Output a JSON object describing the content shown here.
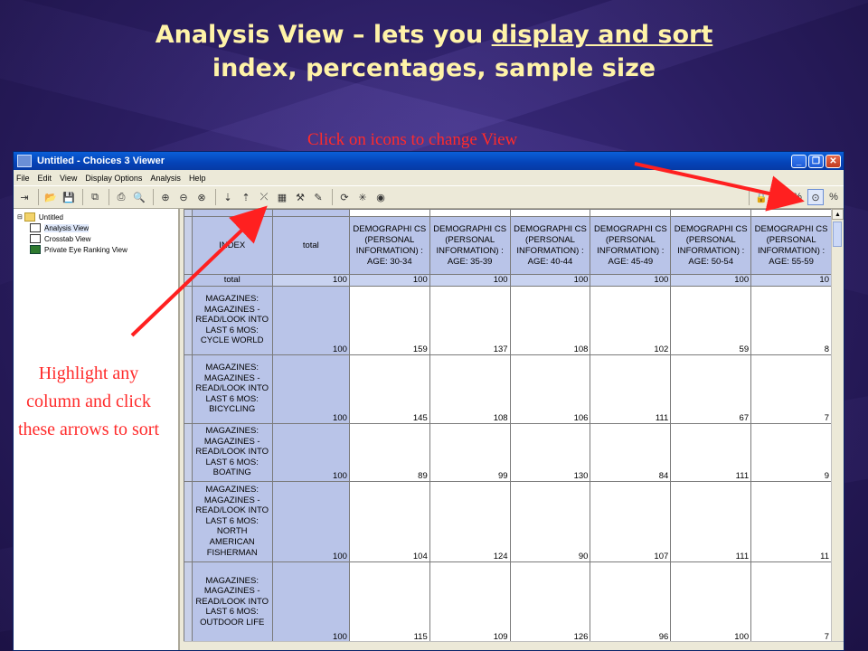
{
  "slide": {
    "title_line1_part1": "Analysis View – lets you ",
    "title_line1_underlined": "display and sort",
    "title_line2": "index, percentages, sample size",
    "hint_top": "Click on icons to change View",
    "hint_left": "Highlight any column and click these arrows to sort"
  },
  "window": {
    "title": "Untitled - Choices 3 Viewer",
    "minimize_label": "_",
    "restore_label": "❐",
    "close_label": "✕"
  },
  "menu": {
    "items": [
      "File",
      "Edit",
      "View",
      "Display Options",
      "Analysis",
      "Help"
    ]
  },
  "toolbar": {
    "icons": [
      "expand-icon",
      "open-folder-icon",
      "save-icon",
      "copy-icon",
      "print-icon",
      "print-preview-icon",
      "zoom-in-icon",
      "zoom-out-icon",
      "zoom-reset-icon",
      "sort-descending-icon",
      "sort-ascending-icon",
      "filter-remove-icon",
      "chart-icon",
      "tools-icon",
      "highlight-icon",
      "refresh-icon",
      "sparkle-icon",
      "globe-icon",
      "lock-icon",
      "users-icon",
      "percent-column-icon",
      "index-100-icon",
      "percent-row-icon"
    ]
  },
  "tree": {
    "root": "Untitled",
    "items": [
      "Analysis View",
      "Crosstab View",
      "Private Eye Ranking View"
    ]
  },
  "grid": {
    "corner_label": "INDEX",
    "total_header": "total",
    "columns": [
      "DEMOGRAPHI CS (PERSONAL INFORMATION) : AGE: 30-34",
      "DEMOGRAPHI CS (PERSONAL INFORMATION) : AGE: 35-39",
      "DEMOGRAPHI CS (PERSONAL INFORMATION) : AGE: 40-44",
      "DEMOGRAPHI CS (PERSONAL INFORMATION) : AGE: 45-49",
      "DEMOGRAPHI CS (PERSONAL INFORMATION) : AGE: 50-54",
      "DEMOGRAPHI CS (PERSONAL INFORMATION) : AGE: 55-59"
    ],
    "total_row": {
      "label": "total",
      "total": "100",
      "values": [
        "100",
        "100",
        "100",
        "100",
        "100",
        "10"
      ]
    },
    "rows": [
      {
        "label": "MAGAZINES: MAGAZINES - READ/LOOK INTO LAST 6 MOS: CYCLE WORLD",
        "total": "100",
        "values": [
          "159",
          "137",
          "108",
          "102",
          "59",
          "8"
        ]
      },
      {
        "label": "MAGAZINES: MAGAZINES - READ/LOOK INTO LAST 6 MOS: BICYCLING",
        "total": "100",
        "values": [
          "145",
          "108",
          "106",
          "111",
          "67",
          "7"
        ]
      },
      {
        "label": "MAGAZINES: MAGAZINES - READ/LOOK INTO LAST 6 MOS: BOATING",
        "total": "100",
        "values": [
          "89",
          "99",
          "130",
          "84",
          "111",
          "9"
        ]
      },
      {
        "label": "MAGAZINES: MAGAZINES - READ/LOOK INTO LAST 6 MOS: NORTH AMERICAN FISHERMAN",
        "total": "100",
        "values": [
          "104",
          "124",
          "90",
          "107",
          "111",
          "11"
        ]
      },
      {
        "label": "MAGAZINES: MAGAZINES - READ/LOOK INTO LAST 6 MOS: OUTDOOR LIFE",
        "total": "100",
        "values": [
          "115",
          "109",
          "126",
          "96",
          "100",
          "7"
        ]
      }
    ]
  },
  "colors": {
    "slide_bg": "#2b1f62",
    "title_yellow": "#fff3a8",
    "annotation_red": "#ff2b2b",
    "grid_header_blue": "#b9c4e8",
    "xp_titlebar": "#0543b7"
  }
}
